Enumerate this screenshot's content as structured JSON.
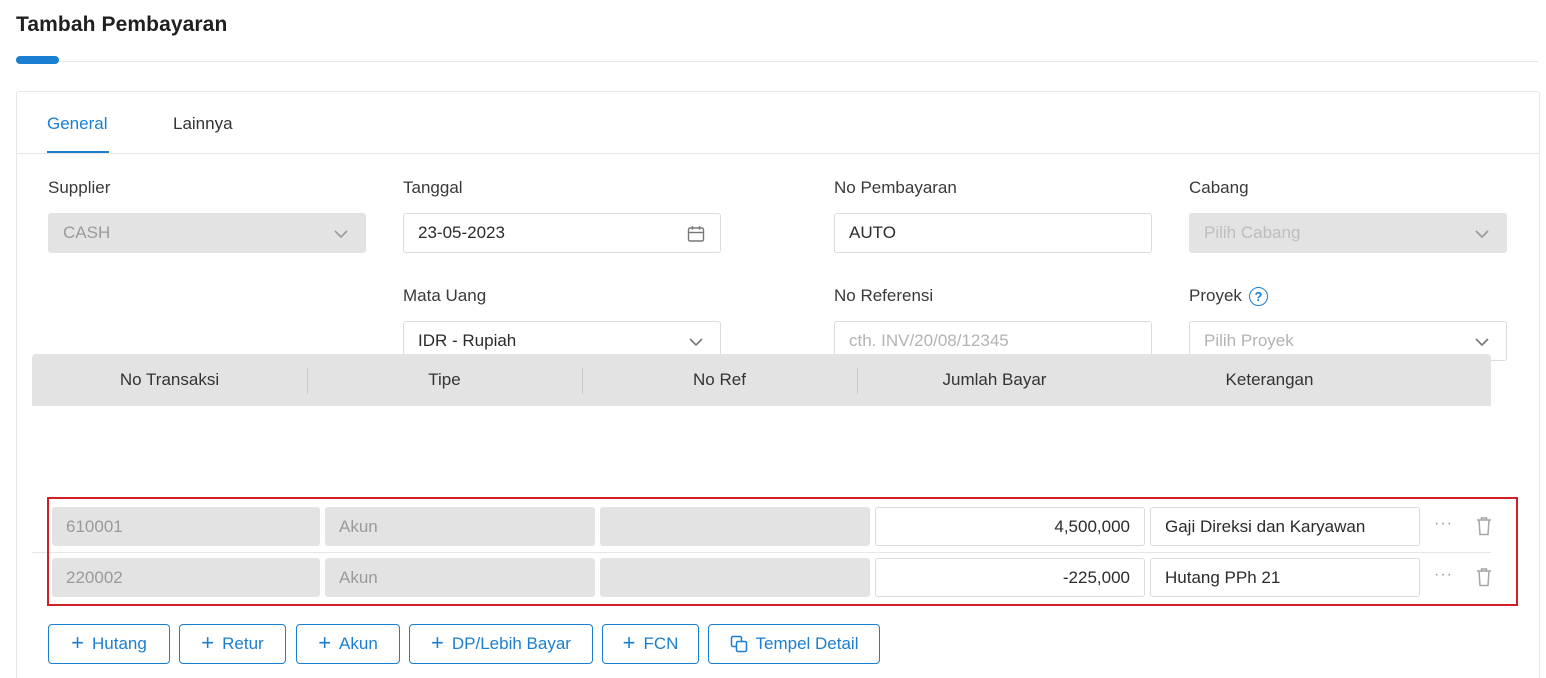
{
  "page": {
    "title": "Tambah Pembayaran"
  },
  "tabs": [
    {
      "label": "General",
      "active": true
    },
    {
      "label": "Lainnya",
      "active": false
    }
  ],
  "form": {
    "supplier": {
      "label": "Supplier",
      "value": "CASH",
      "disabled": true
    },
    "tanggal": {
      "label": "Tanggal",
      "value": "23-05-2023"
    },
    "no_pembayaran": {
      "label": "No Pembayaran",
      "value": "AUTO"
    },
    "cabang": {
      "label": "Cabang",
      "placeholder": "Pilih Cabang",
      "disabled": true
    },
    "mata_uang": {
      "label": "Mata Uang",
      "value": "IDR - Rupiah"
    },
    "no_referensi": {
      "label": "No Referensi",
      "placeholder": "cth. INV/20/08/12345"
    },
    "proyek": {
      "label": "Proyek",
      "placeholder": "Pilih Proyek",
      "help_icon": "question-circle-icon"
    }
  },
  "table": {
    "columns": [
      "No Transaksi",
      "Tipe",
      "No Ref",
      "Jumlah Bayar",
      "Keterangan"
    ],
    "rows": [
      {
        "no_transaksi": "610001",
        "tipe": "Akun",
        "no_ref": "",
        "jumlah_bayar": "4,500,000",
        "keterangan": "Gaji Direksi dan Karyawan"
      },
      {
        "no_transaksi": "220002",
        "tipe": "Akun",
        "no_ref": "",
        "jumlah_bayar": "-225,000",
        "keterangan": "Hutang PPh 21"
      }
    ],
    "row_actions": {
      "more_icon": "ellipsis-icon",
      "delete_icon": "trash-icon"
    }
  },
  "actions": {
    "hutang": "Hutang",
    "retur": "Retur",
    "akun": "Akun",
    "dp_lebih_bayar": "DP/Lebih Bayar",
    "fcn": "FCN",
    "tempel_detail": "Tempel Detail"
  },
  "colors": {
    "accent": "#1a7fd1",
    "highlight": "#d21f26",
    "disabled_bg": "#e3e3e3"
  }
}
